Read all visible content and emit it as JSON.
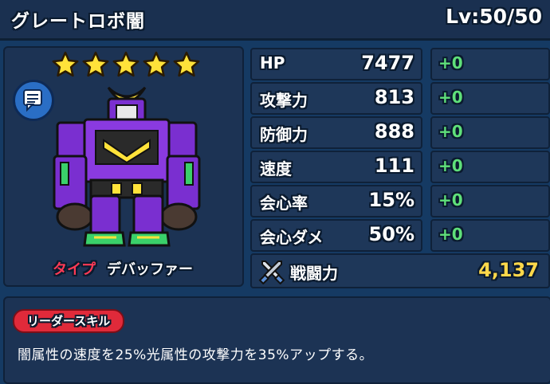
{
  "header": {
    "name": "グレートロボ闇",
    "level": "Lv:50/50"
  },
  "character": {
    "rarity_stars": 5,
    "type_label": "タイプ",
    "type_value": "デバッファー"
  },
  "stats": [
    {
      "label": "HP",
      "value": "7477",
      "bonus": "+0"
    },
    {
      "label": "攻撃力",
      "value": "813",
      "bonus": "+0"
    },
    {
      "label": "防御力",
      "value": "888",
      "bonus": "+0"
    },
    {
      "label": "速度",
      "value": "111",
      "bonus": "+0"
    },
    {
      "label": "会心率",
      "value": "15%",
      "bonus": "+0"
    },
    {
      "label": "会心ダメ",
      "value": "50%",
      "bonus": "+0"
    }
  ],
  "power": {
    "label": "戦闘力",
    "value": "4,137"
  },
  "leader_skill": {
    "tag": "リーダースキル",
    "description": "闇属性の速度を25%光属性の攻撃力を35%アップする。"
  },
  "colors": {
    "background": "#153a63",
    "accent_red": "#e02a3a",
    "bonus_green": "#5fe07a",
    "power_gold": "#ffd84a",
    "robot_purple": "#7a2fd0"
  }
}
